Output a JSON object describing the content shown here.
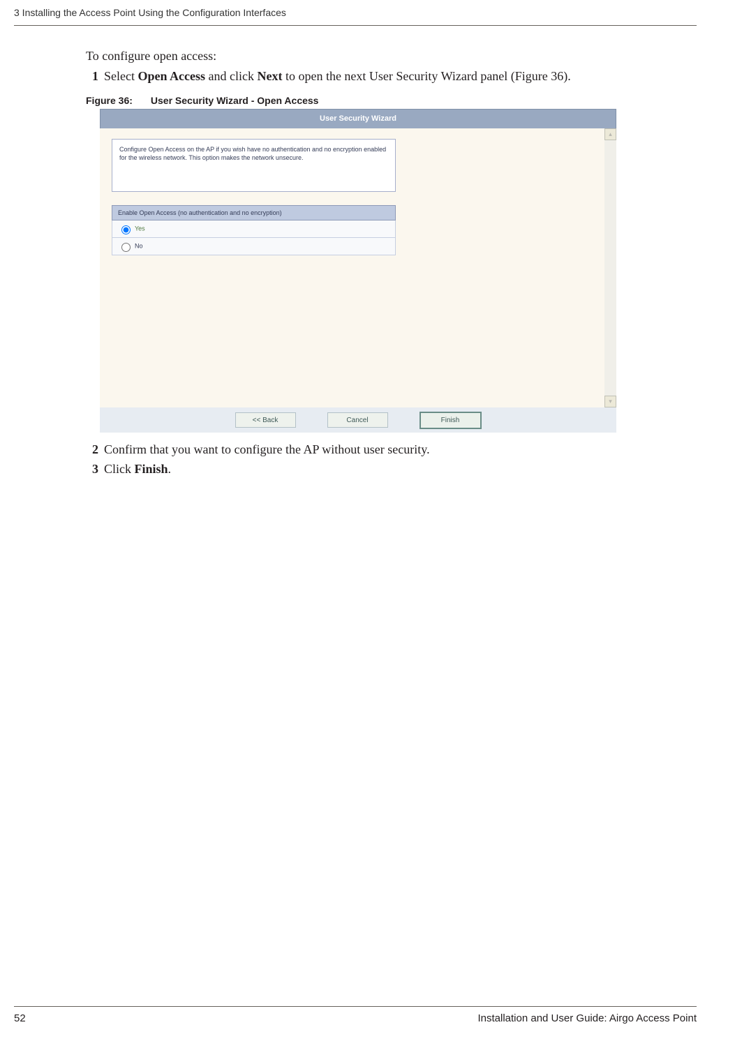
{
  "header": "3  Installing the Access Point Using the Configuration Interfaces",
  "intro": "To configure open access:",
  "step1": {
    "num": "1",
    "prefix": "Select ",
    "bold1": "Open Access",
    "mid": " and click ",
    "bold2": "Next",
    "suffix": " to open the next User Security Wizard panel (Figure 36)."
  },
  "figure": {
    "label": "Figure 36:",
    "title": "User Security Wizard - Open Access"
  },
  "wizard": {
    "title": "User Security Wizard",
    "info": "Configure Open Access on the AP if you wish have no authentication and no encryption enabled for the wireless network. This option makes the network unsecure.",
    "option_header": "Enable Open Access (no authentication and no encryption)",
    "yes": "Yes",
    "no": "No",
    "buttons": {
      "back": "<< Back",
      "cancel": "Cancel",
      "finish": "Finish"
    }
  },
  "step2": {
    "num": "2",
    "text": "Confirm that you want to configure the AP without user security."
  },
  "step3": {
    "num": "3",
    "prefix": "Click ",
    "bold": "Finish",
    "suffix": "."
  },
  "footer": {
    "page": "52",
    "doc": "Installation and User Guide: Airgo Access Point"
  }
}
